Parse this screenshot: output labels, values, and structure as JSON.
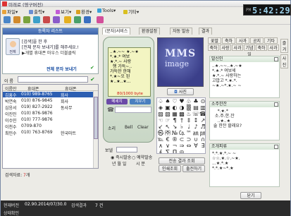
{
  "titlebar": {
    "title": "미래로 (영구버전)"
  },
  "menu": [
    {
      "label": "파일",
      "icon": "file-icon",
      "color": "#e8a33a"
    },
    {
      "label": "출력",
      "icon": "print-icon",
      "color": "#6a8ed1"
    },
    {
      "label": "보기",
      "icon": "view-icon",
      "color": "#c25bd6"
    },
    {
      "label": "환경",
      "icon": "settings-icon",
      "color": "#d9a020"
    },
    {
      "label": "Tools",
      "icon": "tools-icon",
      "color": "#3aa0d8"
    },
    {
      "label": "기타",
      "icon": "etc-icon",
      "color": "#d9c020"
    }
  ],
  "clock": {
    "ampm": "PM",
    "time": "5:42:29"
  },
  "left_panel": {
    "header": "등록자 리스트",
    "avatar_label": "전체",
    "lines": [
      "[검색]을 한 후",
      "[전체 문자 보내기]를 해주세요.!",
      "▶개별 휴대폰 마우스 더블클릭"
    ],
    "send_all": "전체 문자 보내기"
  },
  "name_search": {
    "label": "이 름",
    "value": ""
  },
  "contacts": {
    "headers": [
      "이름만",
      "휴대폰",
      "휴대폰"
    ],
    "rows": [
      {
        "name": "김흥수",
        "phone": "010) 989-8765",
        "memo": "회사"
      },
      {
        "name": "박연숙",
        "phone": "010) 876-9845",
        "memo": "회사"
      },
      {
        "name": "심응서",
        "phone": "019) 827-2922",
        "memo": "동사무"
      },
      {
        "name": "이진인",
        "phone": "010) 876-9876",
        "memo": ""
      },
      {
        "name": "이수민",
        "phone": "010) 777-9876",
        "memo": ""
      },
      {
        "name": "이천수",
        "phone": "0709-870",
        "memo": ""
      },
      {
        "name": "최민수",
        "phone": "010) 763-8769",
        "memo": "한국마트"
      }
    ]
  },
  "search_count": {
    "label": "검색자료:",
    "value": "7",
    "unit": "개"
  },
  "center_tabs": [
    "(문자)서비스",
    "환경설정",
    "자동 발송",
    "결과"
  ],
  "phone": {
    "message": "..★.~~ ★.~★\n*.★.* 여보\n★.*.~ 사랑\n  행 가득~..\n가득한 한해\n*.★~오 된\n★..★..★...",
    "bytes": "80/1000 byte",
    "keys": [
      {
        "label": "메세지",
        "color": "#6b4aa8"
      },
      {
        "label": "지우기",
        "color": "#4a7fbf"
      }
    ],
    "input_label": "",
    "sound_row": [
      "소리",
      "Bell",
      "Clear"
    ]
  },
  "mms": {
    "line1": "MMS",
    "line2": "image"
  },
  "photo_button": "사진",
  "symbols": [
    "♤",
    "♠",
    "♡",
    "♥",
    "♧",
    "♣",
    "⊙",
    "◈",
    "▣",
    "◐",
    "◑",
    "▒",
    "▤",
    "▥",
    "▨",
    "▧",
    "▦",
    "▩",
    "♨",
    "☏",
    "☎",
    "☜",
    "☞",
    "¶",
    "†",
    "‡",
    "↕",
    "↗",
    "↙",
    "↖",
    "↘",
    "♭",
    "♩",
    "♪",
    "♬",
    "㉿",
    "㈜",
    "№",
    "㏇",
    "™",
    "㏂",
    "㏘",
    "℡",
    "€",
    "®",
    "⊂",
    "⊃",
    "∪",
    "∩",
    "∧",
    "∨",
    "¬",
    "⇒",
    "⇔",
    "∀",
    "∃",
    "∮",
    "∑",
    "∏",
    "◎"
  ],
  "send_section": {
    "label": "보낼",
    "option_instant": "즉시발송",
    "option_reserve": "예약발송",
    "date_row": "년 월 일",
    "time_row": "시 분"
  },
  "buttons": {
    "send": "전송 결과 조회",
    "view_all": "인쇄조회",
    "schedule": "출전하기",
    "close": "닫기"
  },
  "right_tabs": [
    "꽃말",
    "축하",
    "사과",
    "공지",
    "기타",
    "축하",
    "사랑",
    "사과",
    "기념일",
    "축하",
    "사과"
  ],
  "vertical_tabs": [
    "즐겨",
    "사진"
  ],
  "boxes": [
    {
      "title": "발신인",
      "text": "..★.~~..★.~★\n*.★.* 여보세\n★.*.~ 사랑하는\n고맙고 *.★.*.\n~★.~*.★.~ ~"
    },
    {
      "title": "소주한잔",
      "text": "    *.★.*\n  소.주.한.잔\n    ..★..★\n 술 한잔 할래요?"
    },
    {
      "title": "조개피류",
      "text": "*.*.★.*.~ ~\n☆☆.★.☆.~★.\n...★.*.★\n*.*.★~*.★"
    }
  ],
  "status": {
    "label1": "현재버전",
    "value1": "02.90.2014/07/30.0",
    "label2": "검색결과",
    "value2": "7 건",
    "label3": "상태확인"
  }
}
